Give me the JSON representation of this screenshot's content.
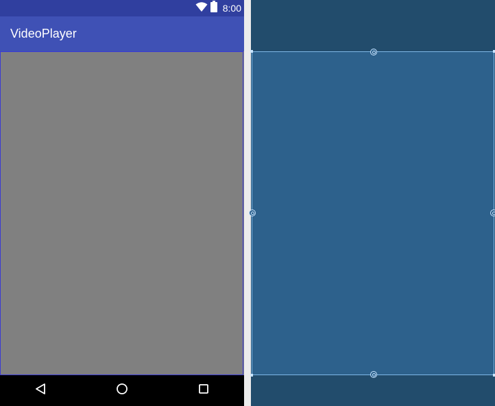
{
  "status_bar": {
    "time": "8:00",
    "icons": [
      "wifi-icon",
      "battery-icon"
    ]
  },
  "app_bar": {
    "title": "VideoPlayer"
  },
  "nav_bar": {
    "buttons": [
      "back-icon",
      "home-icon",
      "recents-icon"
    ]
  },
  "colors": {
    "status_bar": "#303f9f",
    "app_bar": "#3f51b5",
    "video_view": "#808080",
    "blueprint_bg": "#224c6c",
    "blueprint_view": "#2d618c"
  }
}
